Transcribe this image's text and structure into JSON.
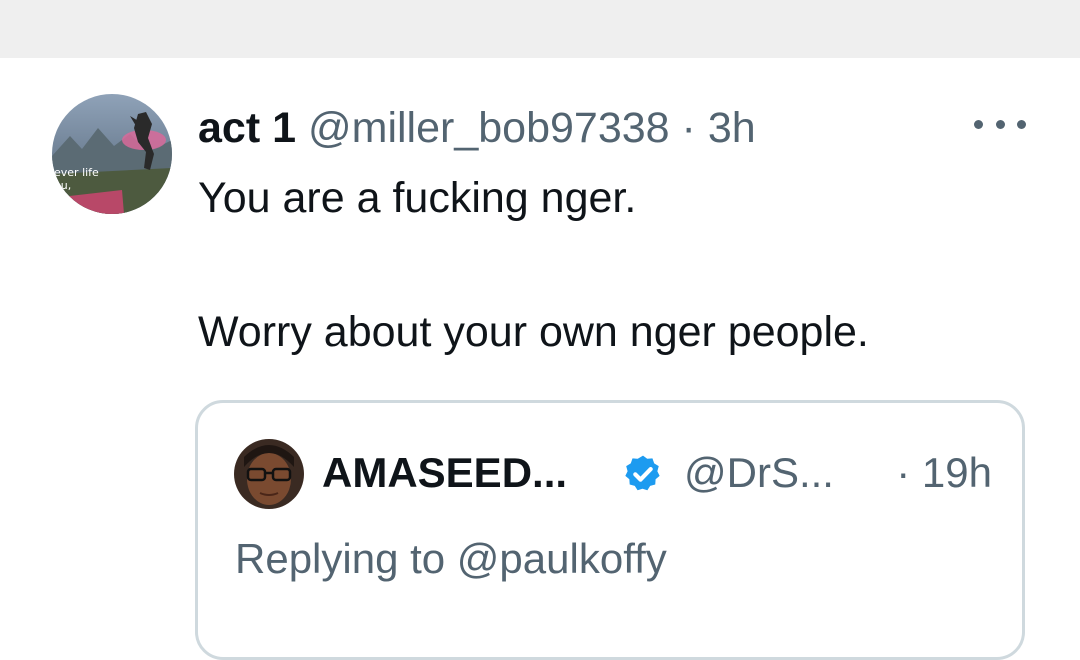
{
  "tweet": {
    "author_name": "act 1",
    "author_handle": "@miller_bob97338",
    "separator": "·",
    "time": "3h",
    "avatar_text_1": "ever life",
    "avatar_text_2": "ou,",
    "more_icon": "more-horizontal-icon",
    "body_line_1": "You are a fucking nger.",
    "body_line_2": "Worry about your own nger people."
  },
  "quote": {
    "author_name": "AMASEED...",
    "author_handle": "@DrS...",
    "time": "· 19h",
    "verified_icon": "verified-badge-icon",
    "verified_color": "#1d9bf0",
    "replying_prefix": "Replying to",
    "replying_mention": "@paulkoffy"
  },
  "colors": {
    "top_band": "#efefef",
    "text_primary": "#0f1419",
    "text_secondary": "#536471",
    "border": "#cfd9de"
  }
}
